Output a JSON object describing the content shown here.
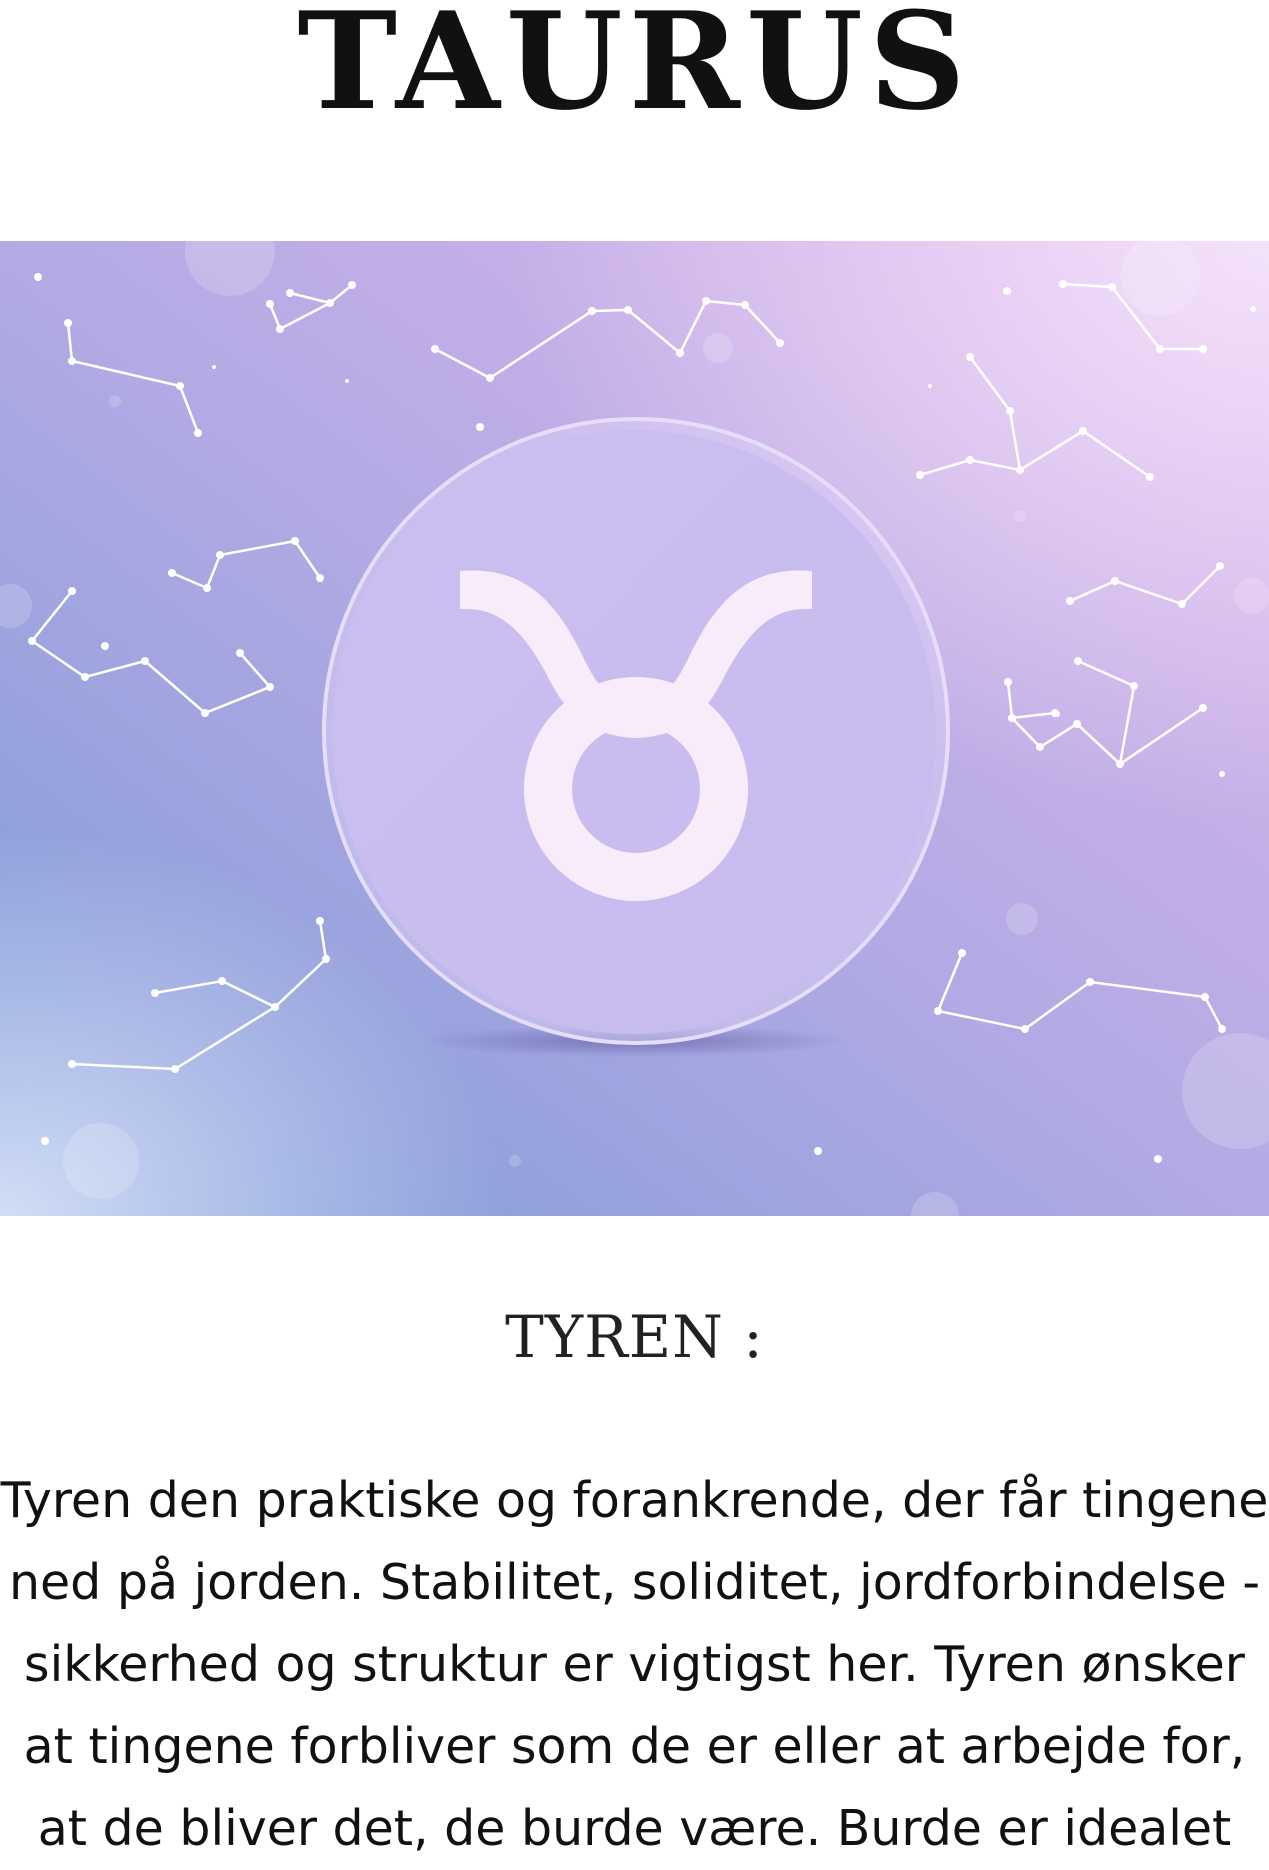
{
  "page": {
    "title": "TAURUS",
    "subtitle": "TYREN :",
    "body": "Tyren den praktiske og forankrende, der får tingene ned på jorden. Stabilitet, soliditet, jordforbindelse - sikkerhed og struktur er vigtigst her. Tyren ønsker at tingene forbliver som de er eller at arbejde for, at de bliver det, de burde være. Burde er idealet"
  },
  "hero_image": {
    "symbol_icon": "taurus-zodiac-icon",
    "colors": {
      "gradient_left": "#7e9bd8",
      "gradient_mid": "#b9aee6",
      "gradient_right": "#dcb6ec",
      "disc": "#c9bdf0",
      "glyph": "#f8ecfb",
      "lines": "#ffffff"
    }
  }
}
